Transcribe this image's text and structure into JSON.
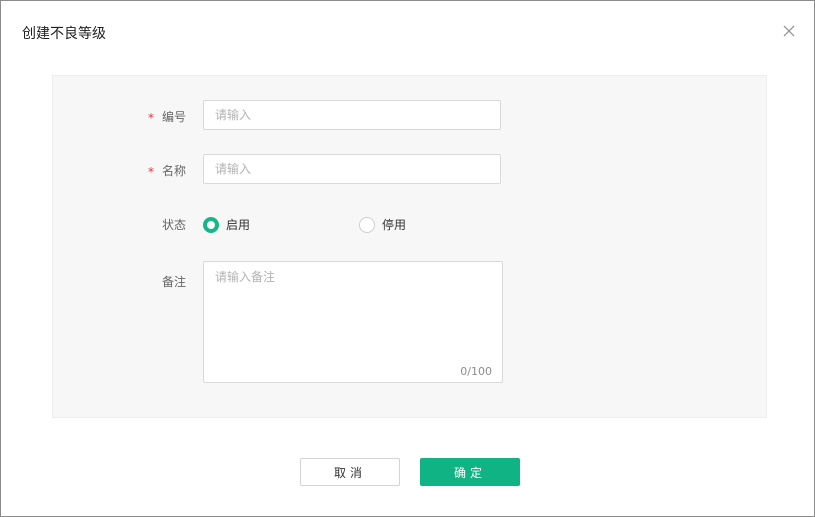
{
  "dialog": {
    "title": "创建不良等级",
    "close_icon": "close-icon"
  },
  "form": {
    "code": {
      "required_mark": "*",
      "label": "编号",
      "placeholder": "请输入",
      "value": ""
    },
    "name": {
      "required_mark": "*",
      "label": "名称",
      "placeholder": "请输入",
      "value": ""
    },
    "status": {
      "label": "状态",
      "options": [
        {
          "label": "启用",
          "checked": true
        },
        {
          "label": "停用",
          "checked": false
        }
      ]
    },
    "remark": {
      "label": "备注",
      "placeholder": "请输入备注",
      "value": "",
      "counter": "0/100"
    }
  },
  "footer": {
    "cancel_label": "取消",
    "ok_label": "确定"
  },
  "colors": {
    "primary": "#10b383",
    "required": "#d9363e"
  }
}
